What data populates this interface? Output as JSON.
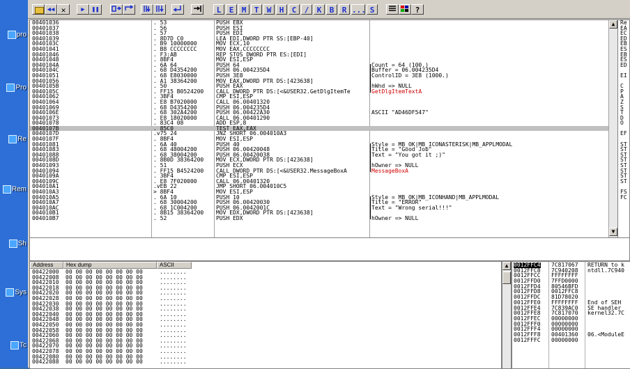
{
  "desktop": {
    "icons": [
      {
        "label": "pro"
      },
      {
        "label": "Pro"
      },
      {
        "label": "Re"
      },
      {
        "label": "Rem"
      },
      {
        "label": "Sh"
      },
      {
        "label": "Sys"
      },
      {
        "label": "Tc"
      }
    ]
  },
  "toolbar": {
    "left_buttons": [
      "◀◀",
      "✕",
      "▶",
      "❚❚",
      "",
      "",
      "",
      "",
      "",
      ""
    ],
    "letters": [
      "L",
      "E",
      "M",
      "T",
      "W",
      "H",
      "C",
      "/",
      "K",
      "B",
      "R",
      "...",
      "S"
    ],
    "help": "?"
  },
  "cpu": {
    "rows": [
      {
        "addr": "00401036",
        "hex": ". 53",
        "dis": "PUSH EBX",
        "com": ""
      },
      {
        "addr": "00401037",
        "hex": ". 56",
        "dis": "PUSH ESI",
        "com": ""
      },
      {
        "addr": "00401038",
        "hex": ". 57",
        "dis": "PUSH EDI",
        "com": ""
      },
      {
        "addr": "00401039",
        "hex": ". 8D7D C0",
        "dis": "LEA EDI,DWORD PTR SS:[EBP-40]",
        "com": ""
      },
      {
        "addr": "0040103C",
        "hex": ". B9 10000000",
        "dis": "MOV ECX,10",
        "com": ""
      },
      {
        "addr": "00401041",
        "hex": ". B8 CCCCCCCC",
        "dis": "MOV EAX,CCCCCCCC",
        "com": ""
      },
      {
        "addr": "00401046",
        "hex": ". F3:AB",
        "dis": "REP STOS DWORD PTR ES:[EDI]",
        "com": ""
      },
      {
        "addr": "00401048",
        "hex": ". 8BF4",
        "dis": "MOV ESI,ESP",
        "com": ""
      },
      {
        "addr": "0040104A",
        "hex": ". 6A 64",
        "dis": "PUSH 64",
        "com": "Count = 64 (100.)"
      },
      {
        "addr": "0040104C",
        "hex": ". 68 D4354200",
        "dis": "PUSH 06.004235D4",
        "com": "Buffer = 06.004235D4"
      },
      {
        "addr": "00401051",
        "hex": ". 68 E8030000",
        "dis": "PUSH 3E8",
        "com": "ControlID = 3E8 (1000.)"
      },
      {
        "addr": "00401056",
        "hex": ". A1 38364200",
        "dis": "MOV EAX,DWORD PTR DS:[423638]",
        "com": ""
      },
      {
        "addr": "0040105B",
        "hex": ". 50",
        "dis": "PUSH EAX",
        "com": "hWnd => NULL"
      },
      {
        "addr": "0040105C",
        "hex": ". FF15 B0524200",
        "dis": "CALL DWORD PTR DS:[<&USER32.GetDlgItemTe",
        "com": "GetDlgItemTextA",
        "red": true
      },
      {
        "addr": "00401062",
        "hex": ". 3BF4",
        "dis": "CMP ESI,ESP",
        "com": ""
      },
      {
        "addr": "00401064",
        "hex": ". E8 B7020000",
        "dis": "CALL 06.00401320",
        "com": ""
      },
      {
        "addr": "00401069",
        "hex": ". 68 D4354200",
        "dis": "PUSH 06.004235D4",
        "com": ""
      },
      {
        "addr": "0040106E",
        "hex": ". 68 302A4200",
        "dis": "PUSH 06.00422A30",
        "com": "ASCII \"AD46DF547\""
      },
      {
        "addr": "00401073",
        "hex": ". E8 18020000",
        "dis": "CALL 06.00401290",
        "com": ""
      },
      {
        "addr": "00401078",
        "hex": ". 83C4 08",
        "dis": "ADD ESP,8",
        "com": ""
      },
      {
        "addr": "0040107B",
        "hex": ". 85C0",
        "dis": "TEST EAX,EAX",
        "com": "",
        "sel": true
      },
      {
        "addr": "0040107D",
        "hex": ".v75 24",
        "dis": "JNZ SHORT 06.004010A3",
        "com": ""
      },
      {
        "addr": "0040107F",
        "hex": ". 8BF4",
        "dis": "MOV ESI,ESP",
        "com": ""
      },
      {
        "addr": "00401081",
        "hex": ". 6A 40",
        "dis": "PUSH 40",
        "com": "Style = MB_OK|MB_ICONASTERISK|MB_APPLMODAL"
      },
      {
        "addr": "00401083",
        "hex": ". 68 48004200",
        "dis": "PUSH 06.00420048",
        "com": "Title = \"Good Job\""
      },
      {
        "addr": "00401088",
        "hex": ". 68 38004200",
        "dis": "PUSH 06.00420038",
        "com": "Text = \"You got it ;)\""
      },
      {
        "addr": "0040108D",
        "hex": ". 8B0D 38364200",
        "dis": "MOV ECX,DWORD PTR DS:[423638]",
        "com": ""
      },
      {
        "addr": "00401093",
        "hex": ". 51",
        "dis": "PUSH ECX",
        "com": "hOwner => NULL"
      },
      {
        "addr": "00401094",
        "hex": ". FF15 B4524200",
        "dis": "CALL DWORD PTR DS:[<&USER32.MessageBoxA",
        "com": "MessageBoxA",
        "red": true
      },
      {
        "addr": "0040109A",
        "hex": ". 3BF4",
        "dis": "CMP ESI,ESP",
        "com": ""
      },
      {
        "addr": "0040109C",
        "hex": ". E8 7F020000",
        "dis": "CALL 06.00401320",
        "com": ""
      },
      {
        "addr": "004010A1",
        "hex": ".vEB 22",
        "dis": "JMP SHORT 06.004010C5",
        "com": ""
      },
      {
        "addr": "004010A3",
        "hex": "> 8BF4",
        "dis": "MOV ESI,ESP",
        "com": ""
      },
      {
        "addr": "004010A5",
        "hex": ". 6A 10",
        "dis": "PUSH 10",
        "com": "Style = MB_OK|MB_ICONHAND|MB_APPLMODAL"
      },
      {
        "addr": "004010A7",
        "hex": ". 68 30004200",
        "dis": "PUSH 06.00420030",
        "com": "Title = \"ERROR\""
      },
      {
        "addr": "004010AC",
        "hex": ". 68 1C004200",
        "dis": "PUSH 06.0042001C",
        "com": "Text = \"Wrong serial!!!\""
      },
      {
        "addr": "004010B1",
        "hex": ". 8B15 38364200",
        "dis": "MOV EDX,DWORD PTR DS:[423638]",
        "com": ""
      },
      {
        "addr": "004010B7",
        "hex": ". 52",
        "dis": "PUSH EDX",
        "com": "hOwner => NULL"
      }
    ],
    "regs": [
      "Re",
      "EA",
      "EC",
      "ED",
      "EB",
      "ES",
      "EB",
      "ES",
      "ED",
      "",
      "EI",
      "",
      "C",
      "P",
      "A",
      "Z",
      "S",
      "T",
      "D",
      "O",
      "",
      "EF",
      "",
      "ST",
      "ST",
      "ST",
      "ST",
      "ST",
      "ST",
      "ST",
      "ST",
      "",
      "FS",
      "FC"
    ]
  },
  "dump": {
    "headers": {
      "address": "Address",
      "hex": "Hex dump",
      "ascii": "ASCII"
    },
    "rows": [
      {
        "addr": "00422000",
        "hex": "00 00 00 00 00 00 00 00",
        "ascii": "........"
      },
      {
        "addr": "00422008",
        "hex": "00 00 00 00 00 00 00 00",
        "ascii": "........"
      },
      {
        "addr": "00422010",
        "hex": "00 00 00 00 00 00 00 00",
        "ascii": "........"
      },
      {
        "addr": "00422018",
        "hex": "00 00 00 00 00 00 00 00",
        "ascii": "........"
      },
      {
        "addr": "00422020",
        "hex": "00 00 00 00 00 00 00 00",
        "ascii": "........"
      },
      {
        "addr": "00422028",
        "hex": "00 00 00 00 00 00 00 00",
        "ascii": "........"
      },
      {
        "addr": "00422030",
        "hex": "00 00 00 00 00 00 00 00",
        "ascii": "........"
      },
      {
        "addr": "00422038",
        "hex": "00 00 00 00 00 00 00 00",
        "ascii": "........"
      },
      {
        "addr": "00422040",
        "hex": "00 00 00 00 00 00 00 00",
        "ascii": "........"
      },
      {
        "addr": "00422048",
        "hex": "00 00 00 00 00 00 00 00",
        "ascii": "........"
      },
      {
        "addr": "00422050",
        "hex": "00 00 00 00 00 00 00 00",
        "ascii": "........"
      },
      {
        "addr": "00422058",
        "hex": "00 00 00 00 00 00 00 00",
        "ascii": "........"
      },
      {
        "addr": "00422060",
        "hex": "00 00 00 00 00 00 00 00",
        "ascii": "........"
      },
      {
        "addr": "00422068",
        "hex": "00 00 00 00 00 00 00 00",
        "ascii": "........"
      },
      {
        "addr": "00422070",
        "hex": "00 00 00 00 00 00 00 00",
        "ascii": "........"
      },
      {
        "addr": "00422078",
        "hex": "00 00 00 00 00 00 00 00",
        "ascii": "........"
      },
      {
        "addr": "00422080",
        "hex": "00 00 00 00 00 00 00 00",
        "ascii": "........"
      },
      {
        "addr": "00422088",
        "hex": "00 00 00 00 00 00 00 00",
        "ascii": "........"
      }
    ]
  },
  "stack": {
    "rows": [
      {
        "addr": "0012FFC4",
        "val": "7C817067",
        "com": "RETURN to k",
        "sel": true
      },
      {
        "addr": "0012FFC8",
        "val": "7C940208",
        "com": "ntdll.7C940"
      },
      {
        "addr": "0012FFCC",
        "val": "FFFFFFFF",
        "com": ""
      },
      {
        "addr": "0012FFD0",
        "val": "7FFD0000",
        "com": ""
      },
      {
        "addr": "0012FFD4",
        "val": "80546BFD",
        "com": ""
      },
      {
        "addr": "0012FFD8",
        "val": "0012FFC8",
        "com": ""
      },
      {
        "addr": "0012FFDC",
        "val": "81D78020",
        "com": ""
      },
      {
        "addr": "0012FFE0",
        "val": "FFFFFFFF",
        "com": "End of SEH"
      },
      {
        "addr": "0012FFE4",
        "val": "7C839AC0",
        "com": "SE handler"
      },
      {
        "addr": "0012FFE8",
        "val": "7C817070",
        "com": "kernel32.7C"
      },
      {
        "addr": "0012FFEC",
        "val": "00000000",
        "com": ""
      },
      {
        "addr": "0012FFF0",
        "val": "00000000",
        "com": ""
      },
      {
        "addr": "0012FFF4",
        "val": "00000000",
        "com": ""
      },
      {
        "addr": "0012FFF8",
        "val": "00401360",
        "com": "06.<ModuleE"
      },
      {
        "addr": "0012FFFC",
        "val": "00000000",
        "com": ""
      }
    ]
  }
}
